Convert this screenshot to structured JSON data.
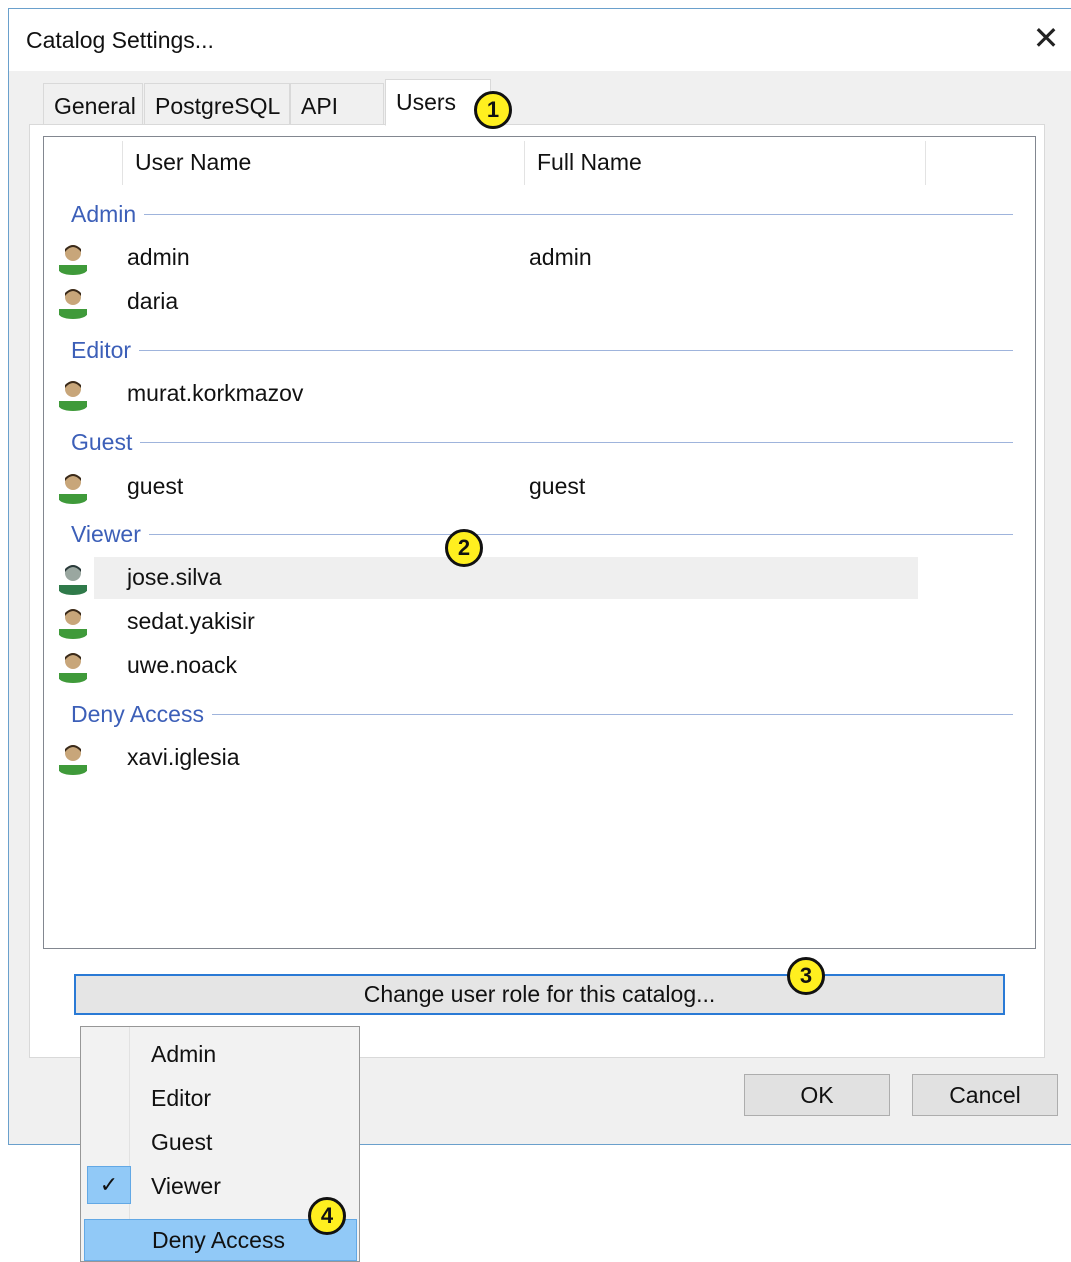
{
  "window": {
    "title": "Catalog Settings...",
    "close_glyph": "✕"
  },
  "tabs": [
    {
      "label": "General",
      "active": false
    },
    {
      "label": "PostgreSQL",
      "active": false
    },
    {
      "label": "API",
      "active": false
    },
    {
      "label": "Users",
      "active": true
    }
  ],
  "columns": {
    "user_name": "User Name",
    "full_name": "Full Name"
  },
  "groups": [
    {
      "label": "Admin",
      "users": [
        {
          "user": "admin",
          "full": "admin"
        },
        {
          "user": "daria",
          "full": ""
        }
      ]
    },
    {
      "label": "Editor",
      "users": [
        {
          "user": "murat.korkmazov",
          "full": ""
        }
      ]
    },
    {
      "label": "Guest",
      "users": [
        {
          "user": "guest",
          "full": "guest"
        }
      ]
    },
    {
      "label": "Viewer",
      "users": [
        {
          "user": "jose.silva",
          "full": "",
          "selected": true
        },
        {
          "user": "sedat.yakisir",
          "full": ""
        },
        {
          "user": "uwe.noack",
          "full": ""
        }
      ]
    },
    {
      "label": "Deny Access",
      "users": [
        {
          "user": "xavi.iglesia",
          "full": ""
        }
      ]
    }
  ],
  "buttons": {
    "change_role": "Change user role for this catalog...",
    "ok": "OK",
    "cancel": "Cancel"
  },
  "context_menu": {
    "items": [
      {
        "label": "Admin",
        "checked": false
      },
      {
        "label": "Editor",
        "checked": false
      },
      {
        "label": "Guest",
        "checked": false
      },
      {
        "label": "Viewer",
        "checked": true
      },
      {
        "label": "Deny Access",
        "checked": false,
        "hovered": true
      }
    ],
    "check_glyph": "✓"
  },
  "callouts": [
    "1",
    "2",
    "3",
    "4"
  ],
  "colors": {
    "group_label": "#3c5fb8",
    "selection_row": "#efefef",
    "menu_highlight": "#91c9f7",
    "focus_border": "#2a7ad5",
    "callout_fill": "#ffef1f",
    "user_icon_body": "#3f9a3a",
    "user_icon_head": "#c8a67a",
    "user_icon_hair": "#3a2a1a"
  },
  "icons": {
    "user_row": "user-icon",
    "selected_user_row": "user-icon-selected"
  }
}
